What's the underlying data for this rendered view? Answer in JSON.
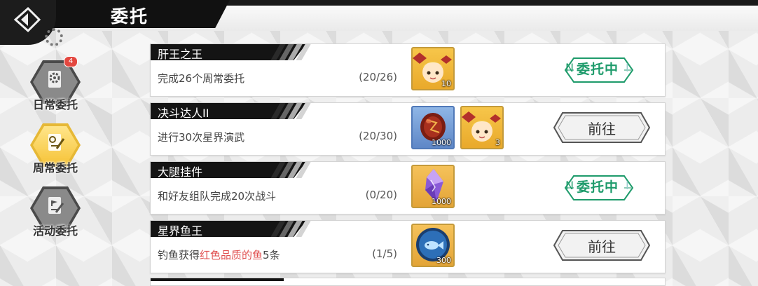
{
  "header": {
    "title": "委托"
  },
  "sidebar": {
    "items": [
      {
        "label": "日常委托",
        "badge": "4",
        "active": false,
        "icon": "gear-document-icon"
      },
      {
        "label": "周常委托",
        "badge": "",
        "active": true,
        "icon": "document-pencil-icon"
      },
      {
        "label": "活动委托",
        "badge": "",
        "active": false,
        "icon": "document-flag-icon"
      }
    ]
  },
  "tasks": [
    {
      "name": "肝王之王",
      "desc": "完成26个周常委托",
      "progress": "(20/26)",
      "rewards": [
        {
          "icon": "character-portrait-icon",
          "qty": "10"
        }
      ],
      "status": "委托中",
      "status_prefix": "N",
      "status_suffix": "I"
    },
    {
      "name": "决斗达人II",
      "desc": "进行30次星界演武",
      "progress": "(20/30)",
      "rewards": [
        {
          "icon": "red-gem-icon",
          "qty": "1000"
        },
        {
          "icon": "character-portrait-icon",
          "qty": "3"
        }
      ],
      "button": "前往"
    },
    {
      "name": "大腿挂件",
      "desc": "和好友组队完成20次战斗",
      "progress": "(0/20)",
      "rewards": [
        {
          "icon": "purple-crystal-icon",
          "qty": "1000"
        }
      ],
      "status": "委托中",
      "status_prefix": "N",
      "status_suffix": "I"
    },
    {
      "name": "星界鱼王",
      "desc_pre": "钓鱼获得",
      "desc_hl": "红色品质的鱼",
      "desc_post": "5条",
      "progress": "(1/5)",
      "rewards": [
        {
          "icon": "blue-fish-coin-icon",
          "qty": "300"
        }
      ],
      "button": "前往"
    }
  ],
  "colors": {
    "accent_green": "#1e9b6b",
    "highlight_red": "#e05050",
    "gold": "#f6c43a"
  }
}
